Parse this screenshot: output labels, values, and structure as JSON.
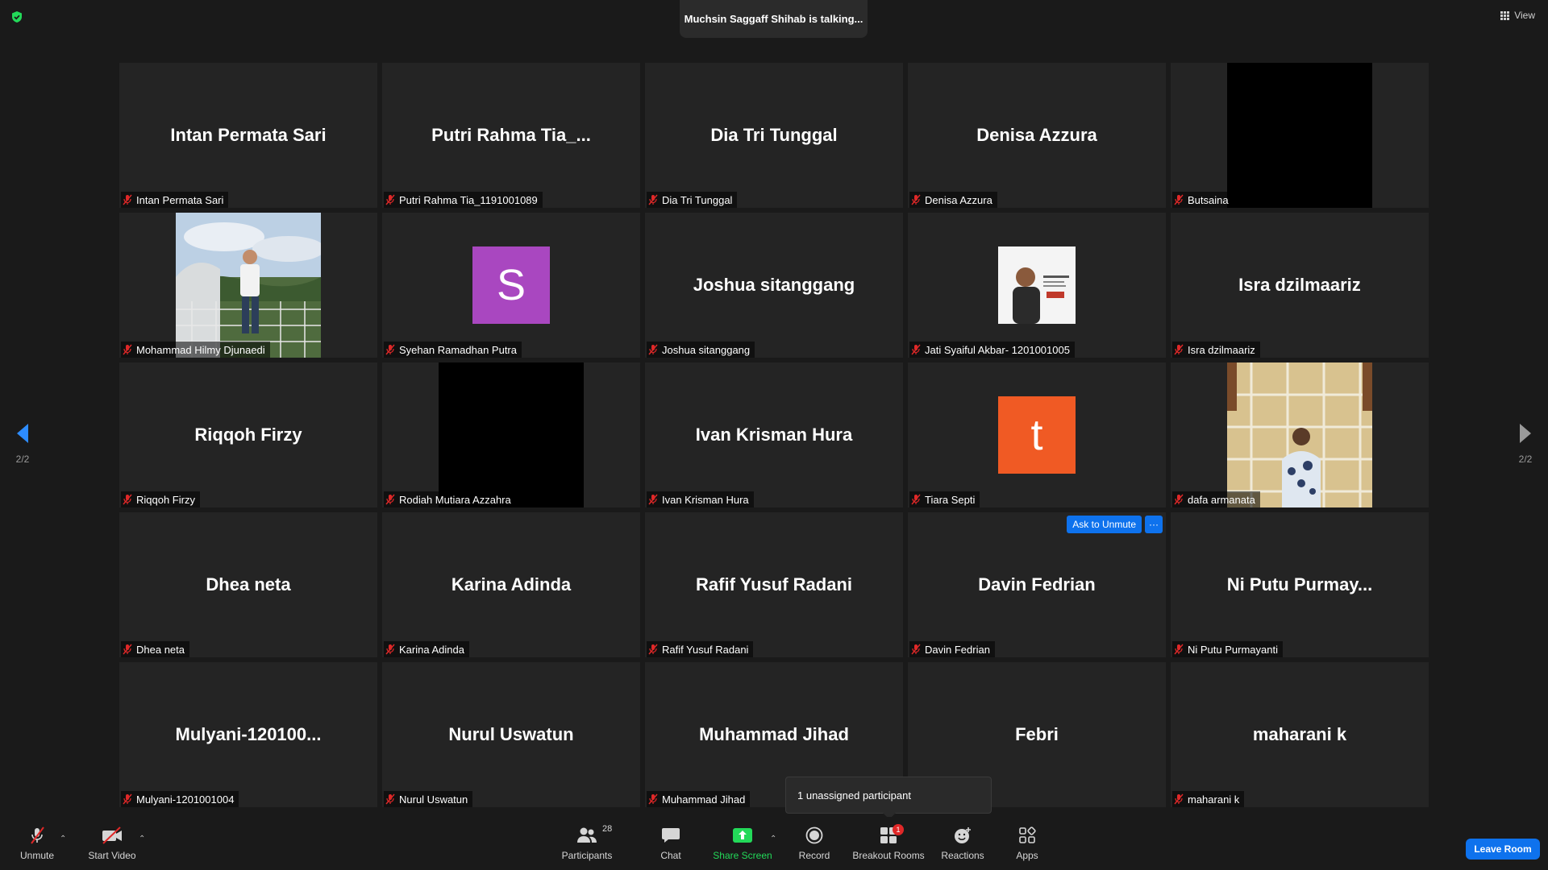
{
  "header": {
    "talking_text": "Muchsin Saggaff Shihab is talking...",
    "view_label": "View"
  },
  "pagination": {
    "left": "2/2",
    "right": "2/2"
  },
  "tiles": [
    {
      "big": "Intan Permata Sari",
      "label": "Intan Permata Sari",
      "kind": "name"
    },
    {
      "big": "Putri  Rahma  Tia_...",
      "label": "Putri Rahma Tia_1191001089",
      "kind": "name"
    },
    {
      "big": "Dia Tri Tunggal",
      "label": "Dia Tri Tunggal",
      "kind": "name"
    },
    {
      "big": "Denisa Azzura",
      "label": "Denisa Azzura",
      "kind": "name"
    },
    {
      "big": "",
      "label": "Butsaina",
      "kind": "black-video"
    },
    {
      "big": "",
      "label": "Mohammad Hilmy Djunaedi",
      "kind": "photo-outdoor"
    },
    {
      "big": "S",
      "label": "Syehan Ramadhan Putra",
      "kind": "avatar",
      "avatar_color": "#a947c0"
    },
    {
      "big": "Joshua sitanggang",
      "label": "Joshua sitanggang",
      "kind": "name"
    },
    {
      "big": "",
      "label": "Jati Syaiful Akbar- 1201001005",
      "kind": "profile-pic"
    },
    {
      "big": "Isra dzilmaariz",
      "label": "Isra dzilmaariz",
      "kind": "name"
    },
    {
      "big": "Riqqoh Firzy",
      "label": "Riqqoh Firzy",
      "kind": "name"
    },
    {
      "big": "",
      "label": "Rodiah Mutiara Azzahra",
      "kind": "black-video"
    },
    {
      "big": "Ivan Krisman Hura",
      "label": "Ivan Krisman Hura",
      "kind": "name"
    },
    {
      "big": "t",
      "label": "Tiara Septi",
      "kind": "avatar",
      "avatar_color": "#f05a24"
    },
    {
      "big": "",
      "label": "dafa armanata",
      "kind": "photo-wall"
    },
    {
      "big": "Dhea neta",
      "label": "Dhea neta",
      "kind": "name"
    },
    {
      "big": "Karina Adinda",
      "label": "Karina Adinda",
      "kind": "name"
    },
    {
      "big": "Rafif Yusuf Radani",
      "label": "Rafif Yusuf Radani",
      "kind": "name"
    },
    {
      "big": "Davin Fedrian",
      "label": "Davin Fedrian",
      "kind": "name",
      "hover": true
    },
    {
      "big": "Ni  Putu  Purmay...",
      "label": "Ni Putu Purmayanti",
      "kind": "name"
    },
    {
      "big": "Mulyani-120100...",
      "label": "Mulyani-1201001004",
      "kind": "name"
    },
    {
      "big": "Nurul Uswatun",
      "label": "Nurul Uswatun",
      "kind": "name"
    },
    {
      "big": "Muhammad Jihad",
      "label": "Muhammad Jihad",
      "kind": "name"
    },
    {
      "big": "Febri",
      "label": "",
      "kind": "name"
    },
    {
      "big": "maharani k",
      "label": "maharani k",
      "kind": "name"
    }
  ],
  "hover_controls": {
    "ask_to_unmute": "Ask to Unmute",
    "more": "···"
  },
  "tooltip": {
    "text": "1 unassigned participant"
  },
  "toolbar": {
    "unmute": "Unmute",
    "start_video": "Start Video",
    "participants": "Participants",
    "participants_count": "28",
    "chat": "Chat",
    "share_screen": "Share Screen",
    "record": "Record",
    "breakout_rooms": "Breakout Rooms",
    "breakout_badge": "1",
    "reactions": "Reactions",
    "apps": "Apps",
    "leave_room": "Leave Room"
  },
  "colors": {
    "accent_blue": "#0e72ed",
    "share_green": "#23d959",
    "mute_red": "#e02828",
    "tile_bg": "#242424",
    "app_bg": "#1a1a1a"
  }
}
